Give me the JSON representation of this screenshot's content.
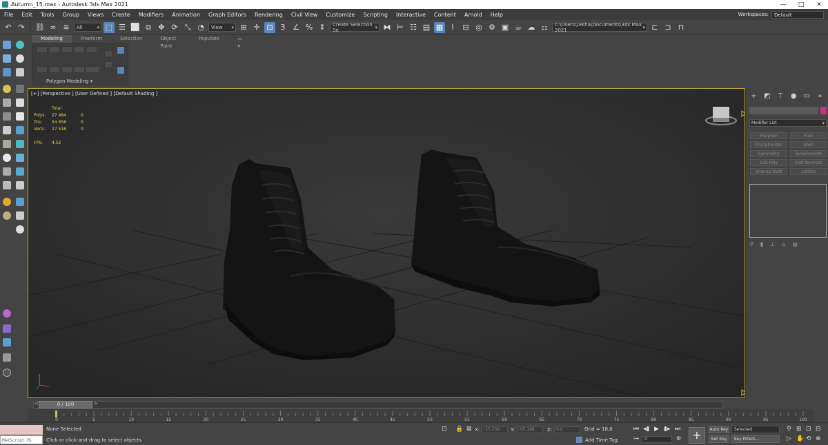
{
  "window": {
    "title": "Autumn_15.max - Autodesk 3ds Max 2021",
    "minimize": "—",
    "maximize": "□",
    "close": "✕"
  },
  "menu": [
    "File",
    "Edit",
    "Tools",
    "Group",
    "Views",
    "Create",
    "Modifiers",
    "Animation",
    "Graph Editors",
    "Rendering",
    "Civil View",
    "Customize",
    "Scripting",
    "Interactive",
    "Content",
    "Arnold",
    "Help"
  ],
  "workspaces": {
    "label": "Workspaces:",
    "value": "Default"
  },
  "toolbar": {
    "filter": "All",
    "ref_coord": "View",
    "snap_label": "3",
    "selection_set": "Create Selection Se",
    "project_path": "C:\\Users\\Lesha\\Documents\\3ds Max 2021"
  },
  "ribbon": {
    "tabs": [
      "Modeling",
      "Freeform",
      "Selection",
      "Object Paint",
      "Populate"
    ],
    "panel_label": "Polygon Modeling ▾"
  },
  "viewport": {
    "label": "[+] [Perspective ] [User Defined ] [Default Shading ]",
    "stats": {
      "header": "Total",
      "rows": [
        {
          "k": "Polys:",
          "v1": "27 484",
          "v2": "0"
        },
        {
          "k": "Tris:",
          "v1": "54 658",
          "v2": "0"
        },
        {
          "k": "Verts:",
          "v1": "27 516",
          "v2": "0"
        }
      ],
      "fps_label": "FPS:",
      "fps_value": "4,52"
    }
  },
  "command_panel": {
    "modifier_list": "Modifier List",
    "modifiers": [
      "Morpher",
      "Push",
      "ProOptimizer",
      "Shell",
      "Symmetry",
      "TurboSmooth",
      "Edit Poly",
      "Edit Normals",
      "Unwrap UVW",
      "Lattice"
    ],
    "accent_color": "#c4347c"
  },
  "timeline": {
    "slider": "0 / 100",
    "prev": "<",
    "next": ">",
    "ticks": [
      "0",
      "5",
      "10",
      "15",
      "20",
      "25",
      "30",
      "35",
      "40",
      "45",
      "50",
      "55",
      "60",
      "65",
      "70",
      "75",
      "80",
      "85",
      "90",
      "95",
      "100"
    ]
  },
  "status": {
    "maxscript": "MAXScript Mi",
    "selection": "None Selected",
    "prompt": "Click or click-and-drag to select objects",
    "x_label": "X:",
    "x_value": "-15,239",
    "y_label": "Y:",
    "y_value": "-95,168",
    "z_label": "Z:",
    "z_value": "0,0",
    "grid": "Grid = 10,0",
    "add_time_tag": "Add Time Tag",
    "frame": "0",
    "auto_key": "Auto Key",
    "set_key": "Set Key",
    "selected_dd": "Selected",
    "key_filters": "Key Filters..."
  }
}
